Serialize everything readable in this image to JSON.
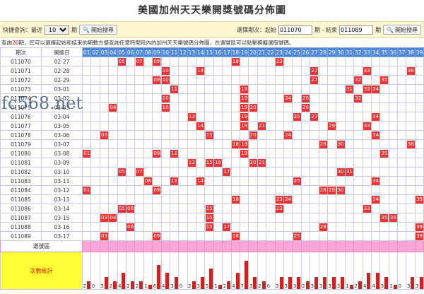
{
  "title": "美國加州天天樂開獎號碼分佈圖",
  "controls": {
    "quick_label": "快捷查詢：最近",
    "quick_value": "10",
    "quick_unit": "期",
    "search_label": "開始搜尋",
    "range_label": "選擇期次：起始",
    "start_value": "011070",
    "range_mid": "期 - 結束",
    "end_value": "011089",
    "range_unit": "期",
    "search_label2": "開始搜尋"
  },
  "notice": {
    "prefix": "查詢",
    "count": "20",
    "suffix": "期，您可以選擇起始和結束的期數方便查詢任意時間段內的加州天天樂號碼分佈圖，在選號區可以點擊模擬選取號碼。"
  },
  "table": {
    "col_issue": "期次",
    "col_date": "開獎日",
    "numbers": [
      "01",
      "02",
      "03",
      "04",
      "05",
      "06",
      "07",
      "08",
      "09",
      "10",
      "11",
      "12",
      "13",
      "14",
      "15",
      "16",
      "17",
      "18",
      "19",
      "20",
      "21",
      "22",
      "23",
      "24",
      "25",
      "26",
      "27",
      "28",
      "29",
      "30",
      "31",
      "32",
      "33",
      "34",
      "35",
      "36",
      "37",
      "38",
      "39"
    ],
    "rows": [
      {
        "issue": "011070",
        "date": "02-27",
        "hits": [
          5,
          7,
          9,
          18,
          23
        ]
      },
      {
        "issue": "011071",
        "date": "02-28",
        "hits": [
          10,
          14,
          27,
          33,
          38
        ]
      },
      {
        "issue": "011072",
        "date": "02-29",
        "hits": [
          9,
          10,
          27,
          32,
          35
        ]
      },
      {
        "issue": "011073",
        "date": "03-01",
        "hits": [
          11,
          19,
          31,
          33,
          34
        ]
      },
      {
        "issue": "011074",
        "date": "03-02",
        "hits": [
          10,
          19,
          24,
          26,
          32
        ]
      },
      {
        "issue": "011075",
        "date": "03-03",
        "hits": [
          4,
          10,
          19,
          20,
          26
        ]
      },
      {
        "issue": "011076",
        "date": "03-04",
        "hits": [
          13,
          19,
          25,
          27,
          34
        ]
      },
      {
        "issue": "011077",
        "date": "03-05",
        "hits": [
          14,
          19,
          21,
          29,
          33
        ]
      },
      {
        "issue": "011078",
        "date": "03-06",
        "hits": [
          3,
          15,
          20,
          24,
          34
        ]
      },
      {
        "issue": "011079",
        "date": "03-07",
        "hits": [
          18,
          19,
          28,
          30,
          38
        ]
      },
      {
        "issue": "011080",
        "date": "03-08",
        "hits": [
          1,
          9,
          11,
          19,
          35
        ]
      },
      {
        "issue": "011081",
        "date": "03-09",
        "hits": [
          13,
          15,
          16,
          20,
          21
        ]
      },
      {
        "issue": "011082",
        "date": "03-10",
        "hits": [
          5,
          7,
          17,
          30,
          31
        ]
      },
      {
        "issue": "011083",
        "date": "03-11",
        "hits": [
          8,
          11,
          14,
          25,
          34
        ]
      },
      {
        "issue": "011084",
        "date": "03-12",
        "hits": [
          1,
          9,
          28,
          29,
          30
        ]
      },
      {
        "issue": "011085",
        "date": "03-13",
        "hits": [
          18,
          23,
          24,
          34,
          39
        ]
      },
      {
        "issue": "011086",
        "date": "03-14",
        "hits": [
          5,
          6,
          15,
          23,
          33
        ]
      },
      {
        "issue": "011087",
        "date": "03-15",
        "hits": [
          3,
          4,
          15,
          35,
          36
        ]
      },
      {
        "issue": "011088",
        "date": "03-16",
        "hits": [
          6,
          15,
          17,
          28,
          39
        ]
      },
      {
        "issue": "011089",
        "date": "03-17",
        "hits": [
          3,
          9,
          18,
          25,
          39
        ]
      }
    ],
    "select_label": "選號區",
    "stat_label": "次數統計",
    "counts": [
      2,
      0,
      3,
      2,
      4,
      2,
      2,
      1,
      6,
      4,
      3,
      0,
      2,
      3,
      5,
      1,
      2,
      4,
      7,
      3,
      2,
      0,
      3,
      3,
      3,
      2,
      3,
      3,
      3,
      3,
      1,
      2,
      4,
      4,
      3,
      1,
      0,
      3,
      3
    ]
  },
  "watermark": "fc568.net",
  "colors": {
    "header_blue": "#4b86d8",
    "hit_red": "#e33",
    "select_pink": "#f9a6d8",
    "stat_yellow": "#ffff33"
  }
}
